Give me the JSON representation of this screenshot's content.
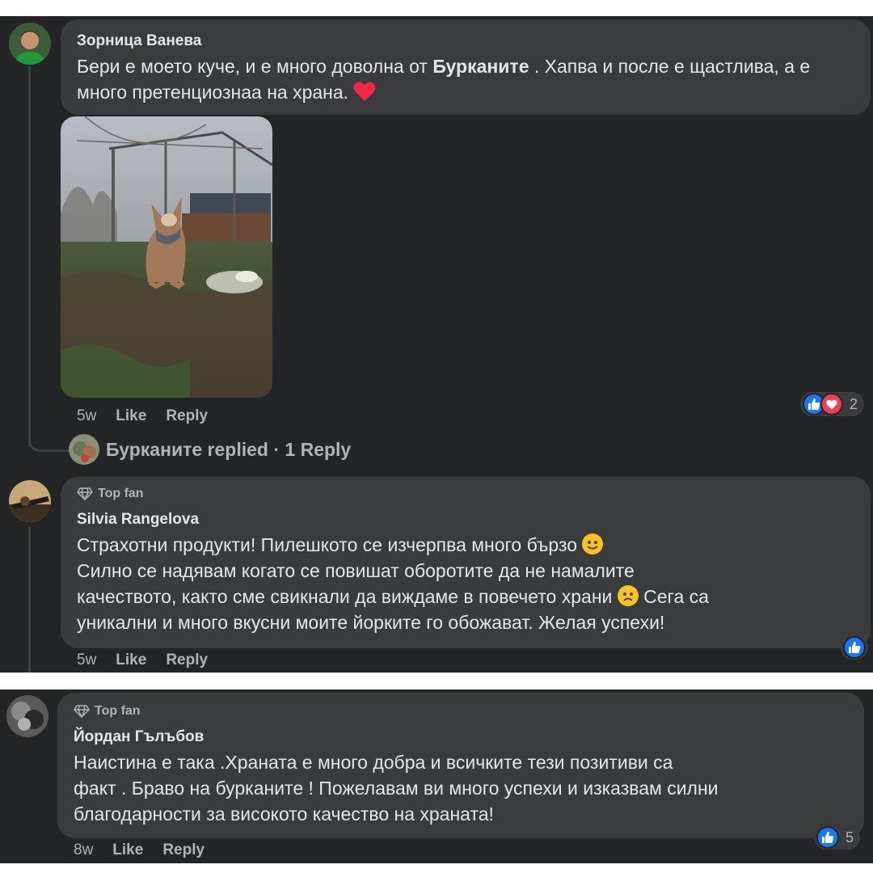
{
  "comments": [
    {
      "author": "Зорница Ванева",
      "text_pre": "Бери е моето куче, и е много доволна от ",
      "text_bold": "Бурканите",
      "text_post": " . Хапва и после е щастлива, а е много претенциознаа на храна.",
      "emoji": "heart",
      "time": "5w",
      "like_label": "Like",
      "reply_label": "Reply",
      "reactions": [
        "like",
        "love"
      ],
      "reaction_count": "2",
      "photo": "dog-sitting-in-garden"
    },
    {
      "badge": "Top fan",
      "author": "Silvia Rangelova",
      "lines": [
        "Страхотни продукти! Пилешкото се изчерпва много бързо",
        "Силно се надявам когато се повишат оборотите да не намалите",
        "качеството, както сме свикнали да виждаме в повечето храни",
        "Сега са",
        "уникални и много вкусни моите йорките го обожават. Желая успехи!"
      ],
      "time": "5w",
      "like_label": "Like",
      "reply_label": "Reply",
      "reactions": [
        "like"
      ]
    },
    {
      "badge": "Top fan",
      "author": "Йордан Гълъбов",
      "lines": [
        "Наистина е така .Храната е много добра и всичките тези позитиви са",
        "факт . Браво на бурканите ! Пожелавам ви много успехи и изказвам силни",
        "благодарности за високото качество на храната!"
      ],
      "time": "8w",
      "like_label": "Like",
      "reply_label": "Reply",
      "reactions": [
        "like"
      ],
      "reaction_count": "5"
    }
  ],
  "replies_link": {
    "page_name": "Бурканите",
    "text": "Бурканите replied · 1 Reply"
  },
  "icons": [
    "diamond-icon",
    "like-reaction-icon",
    "love-reaction-icon",
    "heart-emoji-icon",
    "smile-emoji-icon",
    "sad-emoji-icon"
  ],
  "colors": {
    "panel_bg": "#242526",
    "bubble_bg": "#3a3b3c",
    "text": "#e4e6eb",
    "secondary_text": "#b0b3b8",
    "like_blue": "#1877f2",
    "love_red": "#f33e58"
  }
}
